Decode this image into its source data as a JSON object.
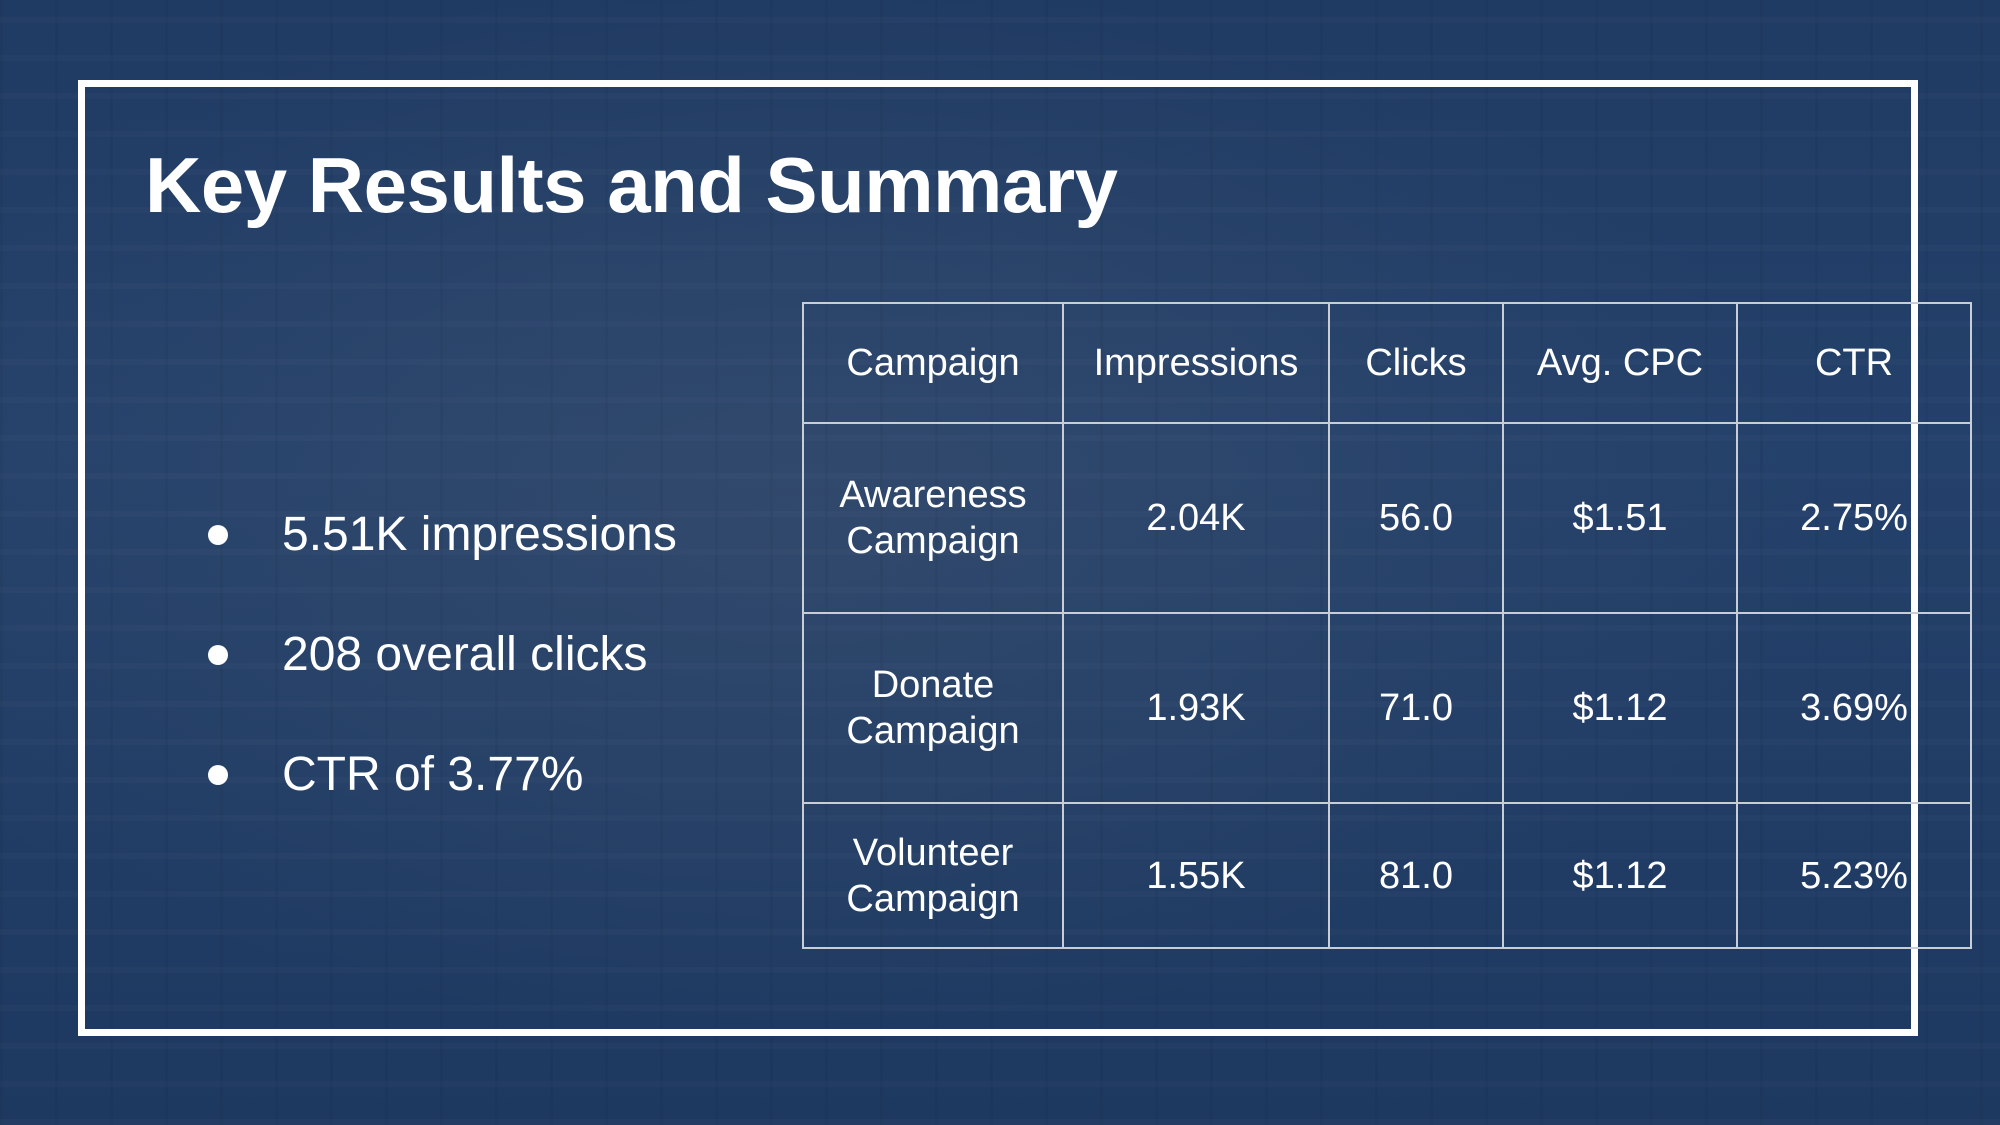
{
  "slide": {
    "title": "Key Results and Summary"
  },
  "bullets": [
    {
      "text": "5.51K impressions"
    },
    {
      "text": "208 overall clicks"
    },
    {
      "text": "CTR of 3.77%"
    }
  ],
  "table": {
    "headers": [
      "Campaign",
      "Impressions",
      "Clicks",
      "Avg. CPC",
      "CTR"
    ],
    "rows": [
      {
        "campaign_line1": "Awareness",
        "campaign_line2": "Campaign",
        "impressions": "2.04K",
        "clicks": "56.0",
        "avg_cpc": "$1.51",
        "ctr": "2.75%"
      },
      {
        "campaign_line1": "Donate",
        "campaign_line2": "Campaign",
        "impressions": "1.93K",
        "clicks": "71.0",
        "avg_cpc": "$1.12",
        "ctr": "3.69%"
      },
      {
        "campaign_line1": "Volunteer",
        "campaign_line2": "Campaign",
        "impressions": "1.55K",
        "clicks": "81.0",
        "avg_cpc": "$1.12",
        "ctr": "5.23%"
      }
    ]
  },
  "colors": {
    "background": "#1f3a62",
    "text": "#ffffff",
    "frame": "#ffffff",
    "table_border": "#c9ced6"
  }
}
